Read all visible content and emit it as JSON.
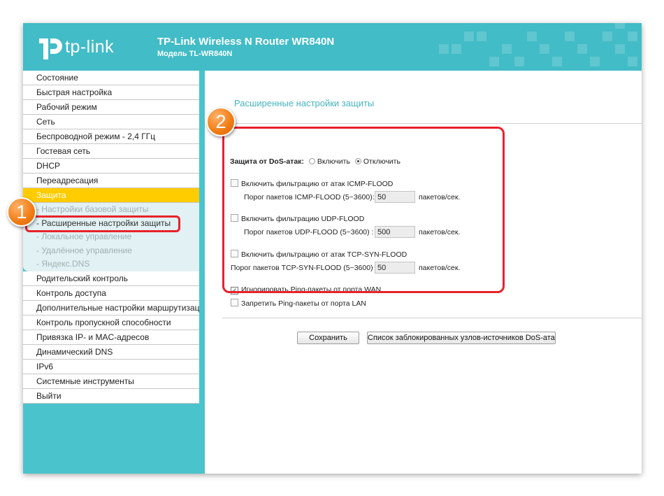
{
  "header": {
    "logo_text": "tp-link",
    "title": "TP-Link Wireless N Router WR840N",
    "model": "Модель TL-WR840N"
  },
  "sidebar": {
    "items_top": [
      {
        "label": "Состояние"
      },
      {
        "label": "Быстрая настройка"
      },
      {
        "label": "Рабочий режим"
      },
      {
        "label": "Сеть"
      },
      {
        "label": "Беспроводной режим - 2,4 ГГц"
      },
      {
        "label": "Гостевая сеть"
      },
      {
        "label": "DHCP"
      },
      {
        "label": "Переадресация"
      },
      {
        "label": "Защита"
      }
    ],
    "sub_items": [
      {
        "label": "- Настройки базовой защиты"
      },
      {
        "label": "- Расширенные настройки защиты"
      },
      {
        "label": "- Локальное управление"
      },
      {
        "label": "- Удалённое управление"
      },
      {
        "label": "- Яндекс.DNS"
      }
    ],
    "items_bottom": [
      {
        "label": "Родительский контроль"
      },
      {
        "label": "Контроль доступа"
      },
      {
        "label": "Дополнительные настройки маршрутизации"
      },
      {
        "label": "Контроль пропускной способности"
      },
      {
        "label": "Привязка IP- и MAC-адресов"
      },
      {
        "label": "Динамический DNS"
      },
      {
        "label": "IPv6"
      },
      {
        "label": "Системные инструменты"
      },
      {
        "label": "Выйти"
      }
    ]
  },
  "main": {
    "title": "Расширенные настройки защиты",
    "dos_label": "Защита от DoS-атак:",
    "dos_enable": "Включить",
    "dos_disable": "Отключить",
    "icmp_check": "Включить фильтрацию от атак ICMP-FLOOD",
    "icmp_threshold_label": "Порог пакетов ICMP-FLOOD (5~3600):",
    "icmp_value": "50",
    "udp_check": "Включить фильтрацию UDP-FLOOD",
    "udp_threshold_label": "Порог пакетов UDP-FLOOD (5~3600) :",
    "udp_value": "500",
    "tcp_check": "Включить фильтрацию от атак TCP-SYN-FLOOD",
    "tcp_threshold_label": "Порог пакетов TCP-SYN-FLOOD (5~3600) :",
    "tcp_value": "50",
    "unit": "пакетов/сек.",
    "ignore_ping_wan": "Игнорировать Ping-пакеты от порта WAN",
    "block_ping_lan": "Запретить Ping-пакеты от порта LAN",
    "save_button": "Сохранить",
    "blocked_list_button": "Список заблокированных узлов-источников DoS-атак"
  },
  "annotations": {
    "badge1": "1",
    "badge2": "2"
  },
  "colors": {
    "header_teal": "#42bcc6",
    "sidebar_teal": "#4bc3cc",
    "active_item": "#ffcc00",
    "section_title": "#45b4bd",
    "highlight_red": "#e8222b",
    "badge_orange": "#f07b13"
  }
}
